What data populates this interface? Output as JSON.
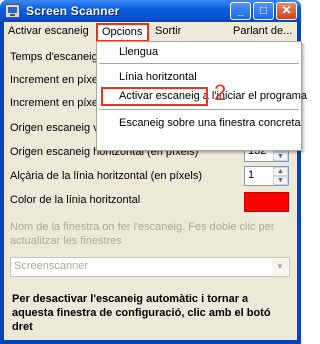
{
  "window": {
    "title": "Screen Scanner"
  },
  "menubar": {
    "items": [
      "Activar escaneig",
      "Opcions",
      "Sortir",
      "Parlant de..."
    ]
  },
  "form": {
    "temps_label": "Temps d'escaneig",
    "inc1_label": "Increment en píxels",
    "inc2_label": "Increment en píxels",
    "origen_v_label": "Origen escaneig vertical",
    "origen_h_label": "Origen escaneig horitzontal (en píxels)",
    "origen_h_value": "132",
    "alcaria_label": "Alçària de la línia horitzontal (en píxels)",
    "alcaria_value": "1",
    "color_label": "Color de la línia horitzontal",
    "color_value": "#ff0000",
    "hint": "Nom de la finestra on fer l'escaneig. Fes doble clic per actualitzar les finestres",
    "combo_value": "Screenscanner",
    "note": "Per desactivar l'escaneig automàtic i tornar a aquesta finestra de configuració, clic amb el botó dret"
  },
  "dropdown": {
    "items": [
      "Llengua",
      "Línia horitzontal",
      "Activar escaneig a l'iniciar el programa",
      "Escaneig sobre una finestra concreta"
    ]
  },
  "annotation": {
    "step": "2",
    "color": "#e8351a"
  },
  "icons": {
    "minimize": "_",
    "maximize": "□",
    "close": "✕",
    "spin_up": "▲",
    "spin_down": "▼",
    "combo_arrow": "▼"
  }
}
